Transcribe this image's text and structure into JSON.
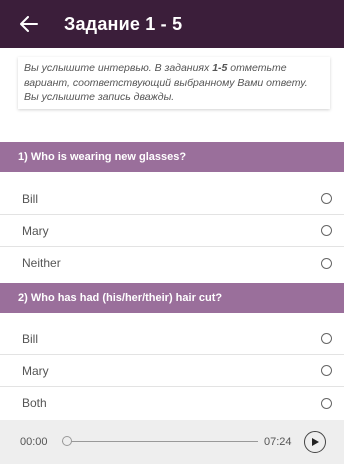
{
  "header": {
    "title": "Задание 1 - 5",
    "back_icon": "arrow-left-icon"
  },
  "instructions": {
    "part1": "Вы услышите интервью. В заданиях ",
    "range": "1-5",
    "part2": " отметьте вариант, соответствующий выбранному Вами ответу. Вы услышите запись дважды."
  },
  "questions": [
    {
      "text": "1) Who is wearing new glasses?",
      "options": [
        "Bill",
        "Mary",
        "Neither"
      ]
    },
    {
      "text": "2) Who has had (his/her/their) hair cut?",
      "options": [
        "Bill",
        "Mary",
        "Both"
      ]
    }
  ],
  "player": {
    "current_time": "00:00",
    "total_time": "07:24",
    "progress": 0,
    "play_icon": "play-icon"
  }
}
